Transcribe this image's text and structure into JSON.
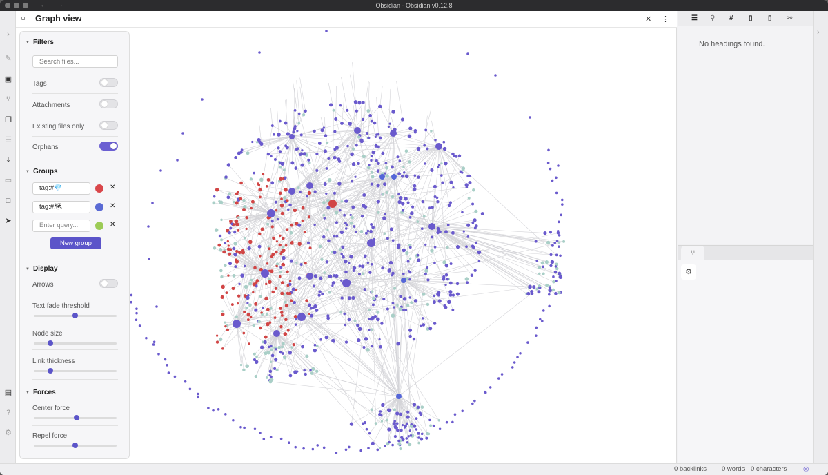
{
  "window": {
    "title": "Obsidian - Obsidian v0.12.8"
  },
  "header": {
    "title": "Graph view"
  },
  "filters": {
    "heading": "Filters",
    "search_placeholder": "Search files...",
    "toggles": [
      {
        "label": "Tags",
        "on": false
      },
      {
        "label": "Attachments",
        "on": false
      },
      {
        "label": "Existing files only",
        "on": false
      },
      {
        "label": "Orphans",
        "on": true
      }
    ]
  },
  "groups": {
    "heading": "Groups",
    "items": [
      {
        "query": "tag:#💎",
        "color": "#d9464a"
      },
      {
        "query": "tag:#🗺",
        "color": "#5a6ad4"
      }
    ],
    "empty_placeholder": "Enter query...",
    "empty_color": "#9ccb56",
    "new_group_label": "New group"
  },
  "display": {
    "heading": "Display",
    "arrows_label": "Arrows",
    "arrows_on": false,
    "sliders": [
      {
        "label": "Text fade threshold",
        "value": 0.5
      },
      {
        "label": "Node size",
        "value": 0.2
      },
      {
        "label": "Link thickness",
        "value": 0.2
      }
    ]
  },
  "forces": {
    "heading": "Forces",
    "sliders": [
      {
        "label": "Center force",
        "value": 0.52
      },
      {
        "label": "Repel force",
        "value": 0.5
      }
    ]
  },
  "outline": {
    "empty_text": "No headings found."
  },
  "status": {
    "backlinks": "0 backlinks",
    "words": "0 words",
    "characters": "0 characters"
  },
  "colors": {
    "node": "#6a5acd",
    "node_blue": "#5566d8",
    "node_red": "#d14545",
    "node_teal": "#a9cfc7",
    "link": "#d4d4d8",
    "accent": "#6b5fd2"
  }
}
